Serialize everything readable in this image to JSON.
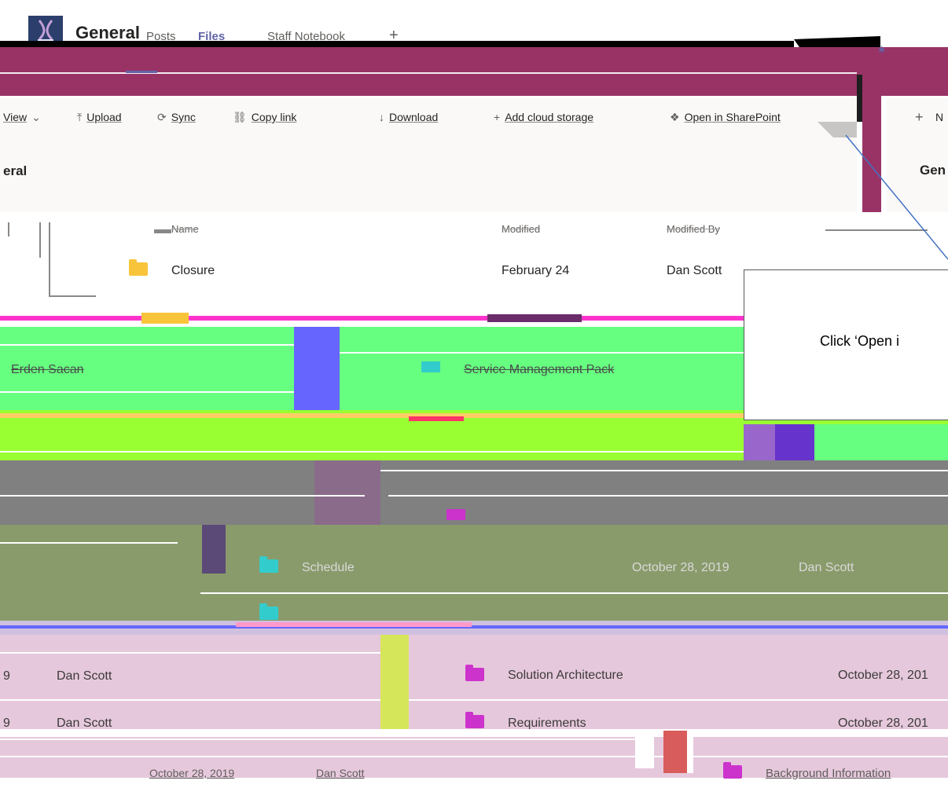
{
  "header": {
    "title": "General",
    "tabs": [
      {
        "label": "Posts"
      },
      {
        "label": "Files",
        "active": true
      },
      {
        "label": "Staff Notebook"
      }
    ],
    "add_tab_label": "+"
  },
  "toolbar": {
    "items": [
      {
        "label": "View",
        "icon": "chevron-down-icon"
      },
      {
        "label": "Upload",
        "icon": "upload-icon"
      },
      {
        "label": "Sync",
        "icon": "sync-icon"
      },
      {
        "label": "Copy link",
        "icon": "link-icon"
      },
      {
        "label": "Download",
        "icon": "download-icon"
      },
      {
        "label": "Add cloud storage",
        "icon": "plus-icon"
      },
      {
        "label": "Open in SharePoint",
        "icon": "sharepoint-icon"
      }
    ],
    "right_plus": "+",
    "right_label": "N"
  },
  "breadcrumb": {
    "left": "eral",
    "right": "Gen"
  },
  "file_list": {
    "columns": [
      "Name",
      "Modified",
      "Modified By"
    ],
    "rows": [
      {
        "name": "Closure",
        "modified": "February 24",
        "modified_by": "Dan Scott"
      }
    ]
  },
  "glitch": {
    "erden": "Erden Sacan",
    "service_pack": "Service Management Pack",
    "schedule": "Schedule",
    "schedule_date": "October 28, 2019",
    "schedule_by": "Dan Scott",
    "solution_by": "Dan Scott",
    "solution_name": "Solution Architecture",
    "solution_date": "October 28, 201",
    "requirements_by": "Dan Scott",
    "requirements_name": "Requirements",
    "requirements_date": "October 28, 201",
    "row_prefix": "9",
    "bottom_date": "October 28, 2019",
    "bottom_by": "Dan Scott",
    "bottom_name": "Background Information"
  },
  "callout": {
    "text": "Click ‘Open i"
  },
  "colors": {
    "maroon": "#993366",
    "accent": "#6264a7",
    "folder_yellow": "#f8c43a",
    "green_band": "#66ff80",
    "lime_band": "#99ff33",
    "grey_band": "#808080",
    "olive_band": "#8a9b6b",
    "pink_band": "#e6c8dc"
  }
}
